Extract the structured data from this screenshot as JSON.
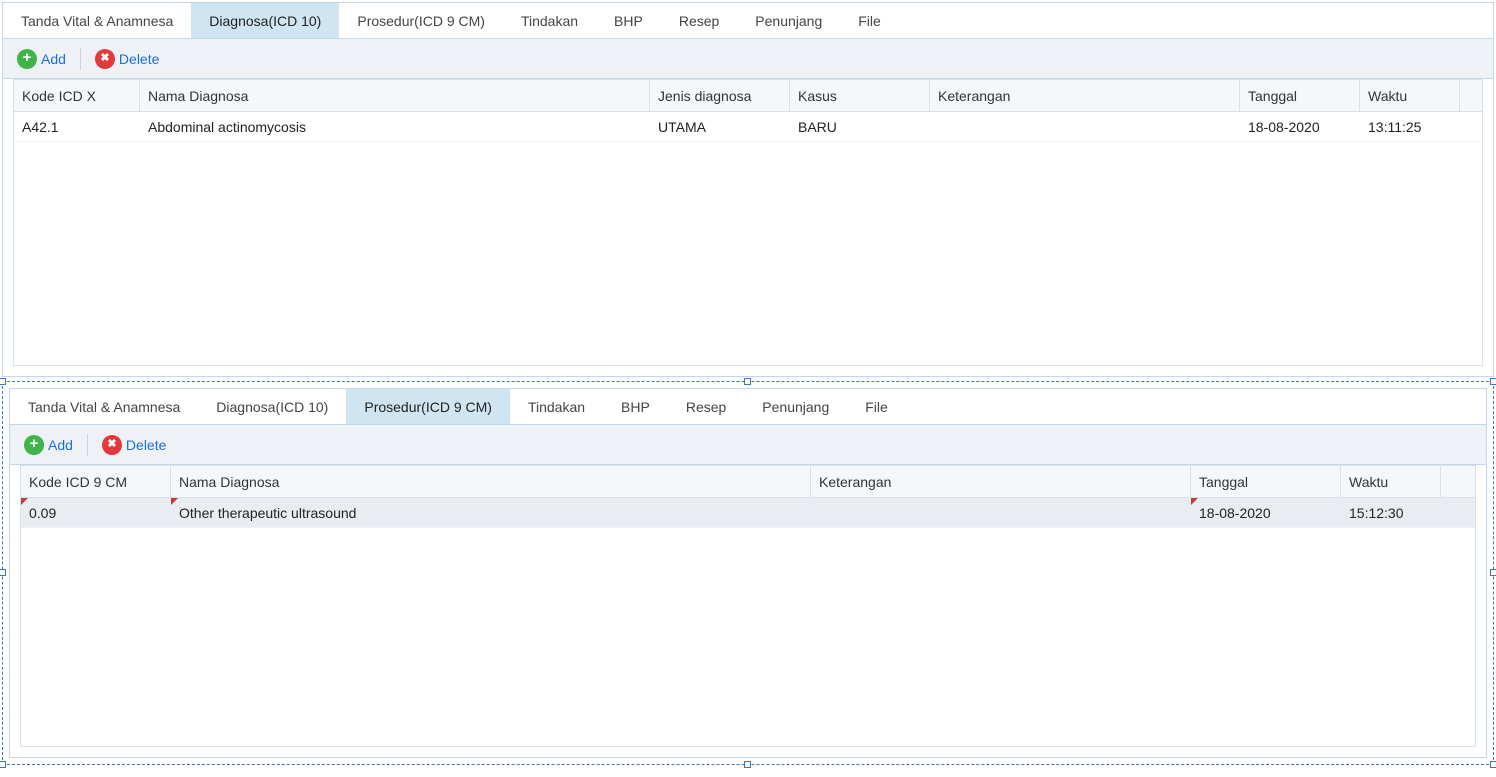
{
  "panel1": {
    "tabs": [
      {
        "label": "Tanda Vital & Anamnesa"
      },
      {
        "label": "Diagnosa(ICD 10)"
      },
      {
        "label": "Prosedur(ICD 9 CM)"
      },
      {
        "label": "Tindakan"
      },
      {
        "label": "BHP"
      },
      {
        "label": "Resep"
      },
      {
        "label": "Penunjang"
      },
      {
        "label": "File"
      }
    ],
    "active_tab_index": 1,
    "toolbar": {
      "add_label": "Add",
      "delete_label": "Delete"
    },
    "columns": [
      "Kode ICD X",
      "Nama Diagnosa",
      "Jenis diagnosa",
      "Kasus",
      "Keterangan",
      "Tanggal",
      "Waktu"
    ],
    "rows": [
      {
        "kode": "A42.1",
        "nama": "Abdominal actinomycosis",
        "jenis": "UTAMA",
        "kasus": "BARU",
        "ket": "",
        "tanggal": "18-08-2020",
        "waktu": "13:11:25"
      }
    ]
  },
  "panel2": {
    "tabs": [
      {
        "label": "Tanda Vital & Anamnesa"
      },
      {
        "label": "Diagnosa(ICD 10)"
      },
      {
        "label": "Prosedur(ICD 9 CM)"
      },
      {
        "label": "Tindakan"
      },
      {
        "label": "BHP"
      },
      {
        "label": "Resep"
      },
      {
        "label": "Penunjang"
      },
      {
        "label": "File"
      }
    ],
    "active_tab_index": 2,
    "toolbar": {
      "add_label": "Add",
      "delete_label": "Delete"
    },
    "columns": [
      "Kode ICD 9 CM",
      "Nama Diagnosa",
      "Keterangan",
      "Tanggal",
      "Waktu"
    ],
    "rows": [
      {
        "kode": "0.09",
        "nama": "Other therapeutic ultrasound",
        "ket": "",
        "tanggal": "18-08-2020",
        "waktu": "15:12:30"
      }
    ]
  }
}
